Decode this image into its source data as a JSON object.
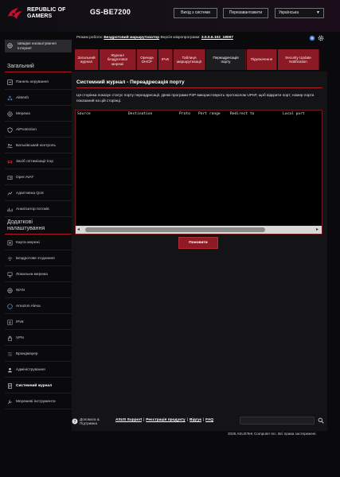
{
  "header": {
    "brand_line1": "REPUBLIC OF",
    "brand_line2": "GAMERS",
    "model": "GS-BE7200",
    "logout_label": "Вихід з системи",
    "reboot_label": "Перезавантажити",
    "language": "Українська"
  },
  "status": {
    "mode_label": "Режим роботи:",
    "mode_value": "Бездротовий маршрутизатор",
    "firmware_label": "Версія мікропрограми:",
    "firmware_value": "3.0.0.6.102_18097"
  },
  "sidebar": {
    "quick_setup": "Швидке налаштування Інтернет",
    "general_title": "Загальний",
    "general_items": [
      {
        "label": "Панель керування",
        "icon": "dashboard-icon"
      },
      {
        "label": "AiMesh",
        "icon": "mesh-icon"
      },
      {
        "label": "Мережа",
        "icon": "network-icon"
      },
      {
        "label": "AiProtection",
        "icon": "shield-icon"
      },
      {
        "label": "Батьківський контроль",
        "icon": "family-icon"
      },
      {
        "label": "Засіб оптимізації ігор",
        "icon": "gamepad-icon"
      },
      {
        "label": "Open NAT",
        "icon": "nat-icon"
      },
      {
        "label": "Адаптивна QoS",
        "icon": "qos-icon"
      },
      {
        "label": "Аналізатор потоків",
        "icon": "analyzer-icon"
      }
    ],
    "advanced_title": "Додаткові налаштування",
    "advanced_items": [
      {
        "label": "Карта мережі",
        "icon": "map-icon"
      },
      {
        "label": "Бездротове з'єднання",
        "icon": "wireless-icon"
      },
      {
        "label": "Локальна мережа",
        "icon": "lan-icon"
      },
      {
        "label": "WAN",
        "icon": "globe-icon"
      },
      {
        "label": "Amazon Alexa",
        "icon": "alexa-icon"
      },
      {
        "label": "IPv6",
        "icon": "ipv6-icon"
      },
      {
        "label": "VPN",
        "icon": "vpn-icon"
      },
      {
        "label": "Брандмауер",
        "icon": "firewall-icon"
      },
      {
        "label": "Адміністрування",
        "icon": "admin-icon"
      },
      {
        "label": "Системний журнал",
        "icon": "log-icon",
        "active": true
      },
      {
        "label": "Мережеві інструменти",
        "icon": "tools-icon"
      }
    ]
  },
  "tabs": [
    {
      "label": "Загальний журнал"
    },
    {
      "label": "Журнал бездротової мережі"
    },
    {
      "label": "Оренда DHCP"
    },
    {
      "label": "IPv6"
    },
    {
      "label": "Таблиця маршрутизації"
    },
    {
      "label": "Переадресація порту",
      "active": true
    },
    {
      "label": "Підключення"
    },
    {
      "label": "Security Update Notification"
    }
  ],
  "panel": {
    "title": "Системний журнал - Переадресація порту",
    "description": "Ця сторінка показує статус порту переадресації. Деякі програми P2P використовують протоколом UPnP, щоб відкрити порт; номер порта показаний на цій сторінці.",
    "columns": [
      "Source",
      "Destination",
      "Proto",
      "Port range",
      "Redirect to",
      "Local port"
    ],
    "refresh_label": "Поновити"
  },
  "footer": {
    "help_line1": "Допомога &",
    "help_line2": "Підтримка",
    "links": [
      "ASUS Support",
      "Реєстрація продукту",
      "Відгук",
      "FAQ"
    ],
    "separator": "|",
    "copyright": "2026 ASUSTeK Computer Inc. Всі права застережені."
  },
  "colors": {
    "accent": "#8c1a24",
    "background": "#0a0a0c",
    "panel": "#141416"
  }
}
